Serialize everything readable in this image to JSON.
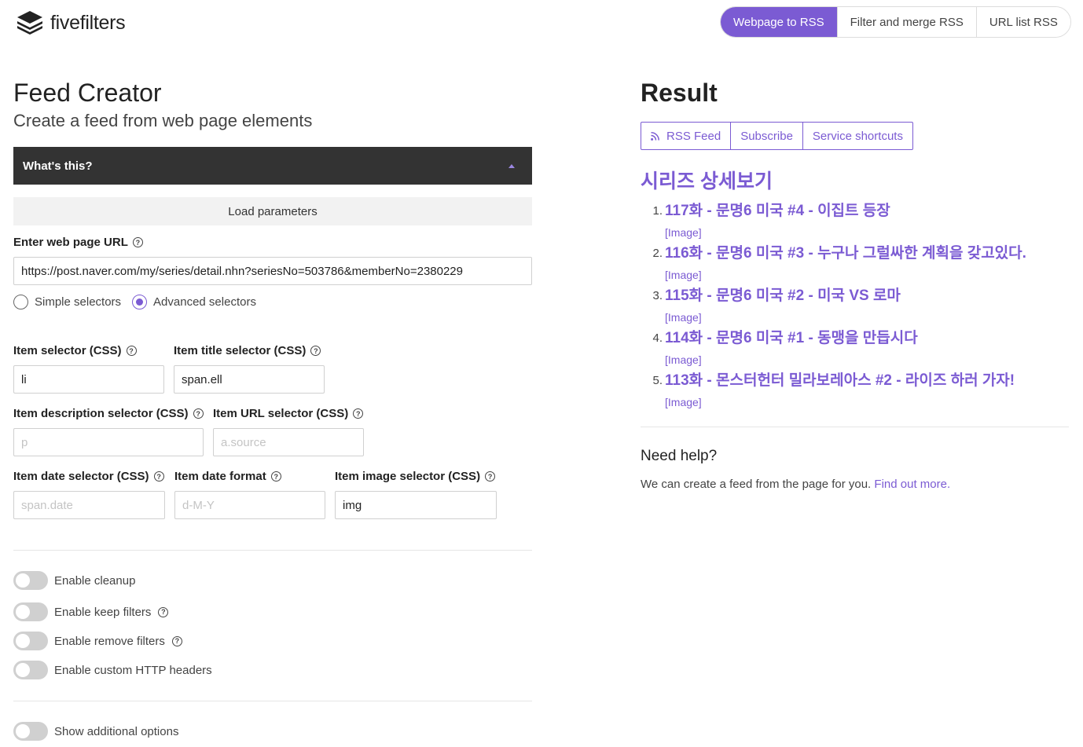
{
  "brand": {
    "name": "fivefilters",
    "icon": "layers-logo-icon"
  },
  "nav": [
    {
      "label": "Webpage to RSS",
      "active": true
    },
    {
      "label": "Filter and merge RSS",
      "active": false
    },
    {
      "label": "URL list RSS",
      "active": false
    }
  ],
  "left": {
    "title": "Feed Creator",
    "subtitle": "Create a feed from web page elements",
    "accordion_label": "What's this?",
    "load_params_label": "Load parameters",
    "url_label": "Enter web page URL",
    "url_value": "https://post.naver.com/my/series/detail.nhn?seriesNo=503786&memberNo=2380229",
    "radio_simple": "Simple selectors",
    "radio_advanced": "Advanced selectors",
    "selected_mode": "Advanced selectors",
    "fields": {
      "item_selector": {
        "label": "Item selector (CSS)",
        "value": "li",
        "placeholder": ""
      },
      "item_title": {
        "label": "Item title selector (CSS)",
        "value": "span.ell",
        "placeholder": ""
      },
      "item_description": {
        "label": "Item description selector (CSS)",
        "value": "",
        "placeholder": "p"
      },
      "item_url": {
        "label": "Item URL selector (CSS)",
        "value": "",
        "placeholder": "a.source"
      },
      "item_date": {
        "label": "Item date selector (CSS)",
        "value": "",
        "placeholder": "span.date"
      },
      "item_date_format": {
        "label": "Item date format",
        "value": "",
        "placeholder": "d-M-Y"
      },
      "item_image": {
        "label": "Item image selector (CSS)",
        "value": "img",
        "placeholder": ""
      }
    },
    "toggles": {
      "cleanup": "Enable cleanup",
      "keep_filters": "Enable keep filters",
      "remove_filters": "Enable remove filters",
      "custom_headers": "Enable custom HTTP headers",
      "additional_options": "Show additional options"
    }
  },
  "right": {
    "title": "Result",
    "buttons": {
      "rss_feed": "RSS Feed",
      "subscribe": "Subscribe",
      "shortcuts": "Service shortcuts"
    },
    "feed_title": "시리즈 상세보기",
    "items": [
      {
        "num": "1.",
        "title": "117화 - 문명6 미국 #4 - 이집트 등장",
        "image": "[Image]"
      },
      {
        "num": "2.",
        "title": "116화 - 문명6 미국 #3 - 누구나 그럴싸한 계획을 갖고있다.",
        "image": "[Image]"
      },
      {
        "num": "3.",
        "title": "115화 - 문명6 미국 #2 - 미국 VS 로마",
        "image": "[Image]"
      },
      {
        "num": "4.",
        "title": "114화 - 문명6 미국 #1 - 동맹을 만듭시다",
        "image": "[Image]"
      },
      {
        "num": "5.",
        "title": "113화 - 몬스터헌터 밀라보레아스 #2 - 라이즈 하러 가자!",
        "image": "[Image]"
      }
    ],
    "help_title": "Need help?",
    "help_text": "We can create a feed from the page for you.",
    "help_link": "Find out more."
  },
  "colors": {
    "accent": "#7b5bd3",
    "dark_bar": "#333333"
  }
}
